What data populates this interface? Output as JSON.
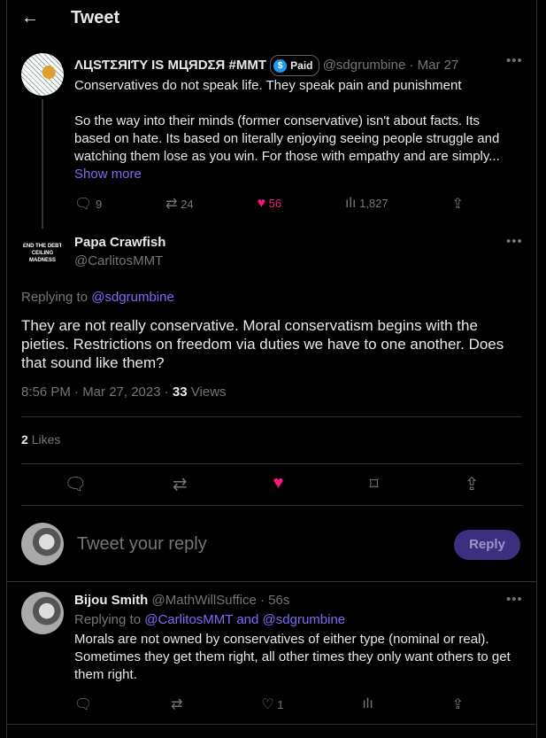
{
  "header": {
    "title": "Tweet",
    "back_icon": "←"
  },
  "parent": {
    "name": "ɅЦSƬΣЯIƬY IS MЦЯDΣЯ #MMT",
    "badge": "Paid",
    "handle": "@sdgrumbine",
    "time": "· Mar 27",
    "text1": "Conservatives do not speak life. They speak pain and punishment",
    "text2": "So the way into their minds (former conservative) isn't about facts. Its based on hate. Its based on literally enjoying seeing people struggle and watching them lose as you win. For those with empathy and are simply...",
    "show_more": "Show more",
    "replies": "9",
    "retweets": "24",
    "likes": "56",
    "views": "1,827"
  },
  "main": {
    "name": "Papa Crawfish",
    "handle": "@CarlitosMMT",
    "avatar_text": "END THE DEBT CEILING MADNESS",
    "replying_label": "Replying to",
    "replying_to": "@sdgrumbine",
    "text": "They are not really conservative. Moral conservatism begins with the pieties. Restrictions on freedom via duties we have to one another. Does that sound like them?",
    "timestamp": "8:56 PM · Mar 27, 2023 · ",
    "views_count": "33",
    "views_label": "Views",
    "likes_count": "2",
    "likes_label": "Likes"
  },
  "composer": {
    "placeholder": "Tweet your reply",
    "button": "Reply"
  },
  "reply": {
    "name": "Bijou Smith",
    "handle": "@MathWillSuffice",
    "time": "· 56s",
    "replying_label": "Replying to",
    "replying_to": "@CarlitosMMT and @sdgrumbine",
    "text": "Morals are not owned by conservatives of either type (nominal or real). Sometimes they get them right, all other times they only want others to get them right.",
    "likes": "1"
  },
  "colors": {
    "accent": "#7a6cf6",
    "like": "#f91880",
    "reply_button": "#3b2f80"
  }
}
